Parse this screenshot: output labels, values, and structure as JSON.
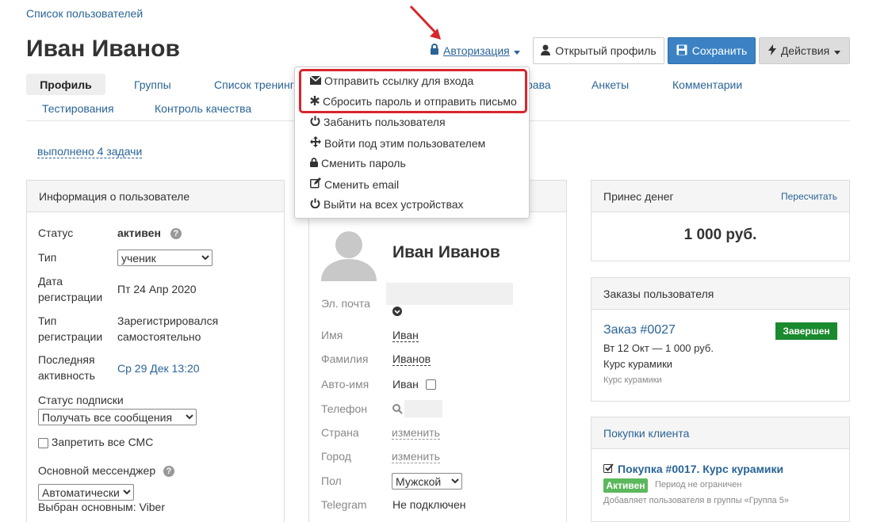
{
  "breadcrumb": "Список пользователей",
  "title": "Иван Иванов",
  "header": {
    "auth_label": "Авторизация",
    "open_profile_label": "Открытый профиль",
    "save_label": "Сохранить",
    "actions_label": "Действия"
  },
  "tabs": {
    "row1": [
      "Профиль",
      "Группы",
      "Список тренинг",
      "рава",
      "Анкеты",
      "Комментарии"
    ],
    "row2": [
      "Тестирования",
      "Контроль качества"
    ]
  },
  "tasks_link": "выполнено 4 задачи",
  "auth_menu": {
    "items": [
      "Отправить ссылку для входа",
      "Сбросить пароль и отправить письмо",
      "Забанить пользователя",
      "Войти под этим пользователем",
      "Сменить пароль",
      "Сменить email",
      "Выйти на всех устройствах"
    ]
  },
  "user_info": {
    "title": "Информация о пользователе",
    "status_label": "Статус",
    "status_value": "активен",
    "type_label": "Тип",
    "type_value": "ученик",
    "reg_date_label_1": "Дата",
    "reg_date_label_2": "регистрации",
    "reg_date_value": "Пт 24 Апр 2020",
    "reg_type_label_1": "Тип",
    "reg_type_label_2": "регистрации",
    "reg_type_value_1": "Зарегистрировался",
    "reg_type_value_2": "самостоятельно",
    "last_activity_label_1": "Последняя",
    "last_activity_label_2": "активность",
    "last_activity_value": "Ср 29 Дек 13:20",
    "subscription_label": "Статус подписки",
    "subscription_value": "Получать все сообщения",
    "ban_sms_label": "Запретить все СМС",
    "messenger_label": "Основной мессенджер",
    "messenger_value": "Автоматически",
    "messenger_chosen": "Выбран основным: Viber"
  },
  "profile_card": {
    "name": "Иван Иванов",
    "email_label": "Эл. почта",
    "first_name_label": "Имя",
    "first_name_value": "Иван",
    "last_name_label": "Фамилия",
    "last_name_value": "Иванов",
    "auto_name_label": "Авто-имя",
    "auto_name_value": "Иван",
    "phone_label": "Телефон",
    "country_label": "Страна",
    "country_value": "изменить",
    "city_label": "Город",
    "city_value": "изменить",
    "gender_label": "Пол",
    "gender_value": "Мужской",
    "telegram_label": "Telegram",
    "telegram_value": "Не подключен"
  },
  "money": {
    "title": "Принес денег",
    "recalc": "Пересчитать",
    "amount": "1 000 руб."
  },
  "orders": {
    "title": "Заказы пользователя",
    "order_title": "Заказ #0027",
    "order_status": "Завершен",
    "order_date": "Вт 12 Окт — 1 000 руб.",
    "order_product": "Курс курамики",
    "order_product_small": "Курс курамики"
  },
  "purchases": {
    "title": "Покупки клиента",
    "purchase_title": "Покупка #0017. Курс курамики",
    "purchase_status": "Активен",
    "purchase_period": "Период не ограничен",
    "purchase_groups": "Добавляет пользователя в группы «Группа 5»"
  },
  "colors": {
    "link": "#2a6496",
    "save": "#3a82c4",
    "highlight": "#d8262c",
    "done_badge": "#1a8a2e",
    "active_badge": "#5cb85c"
  }
}
